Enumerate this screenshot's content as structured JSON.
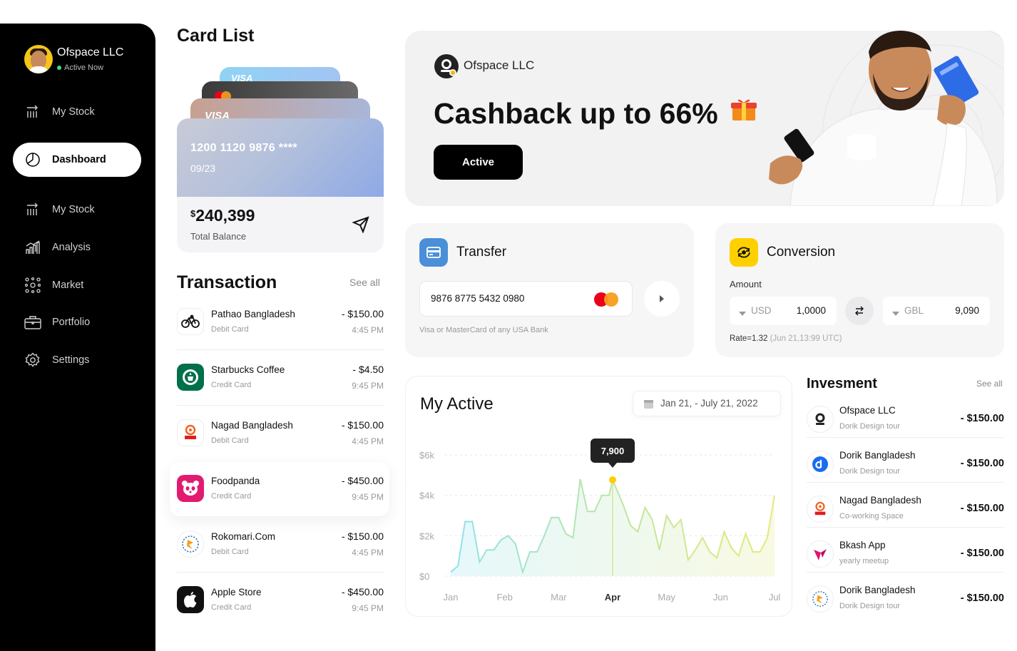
{
  "sidebar": {
    "org_name": "Ofspace LLC",
    "status": "Active Now",
    "items": [
      {
        "label": "My Stock",
        "icon": "stock-icon"
      },
      {
        "label": "Dashboard",
        "icon": "pie-chart-icon",
        "active": true
      },
      {
        "label": "My Stock",
        "icon": "stock-icon"
      },
      {
        "label": "Analysis",
        "icon": "bar-chart-icon"
      },
      {
        "label": "Market",
        "icon": "network-icon"
      },
      {
        "label": "Portfolio",
        "icon": "briefcase-icon"
      },
      {
        "label": "Settings",
        "icon": "gear-icon"
      }
    ]
  },
  "card_list": {
    "title": "Card List",
    "card_number": "1200 1120 9876 ****",
    "expiry": "09/23",
    "brand_back": "VISA",
    "currency_symbol": "$",
    "balance": "240,399",
    "balance_label": "Total Balance"
  },
  "transactions": {
    "title": "Transaction",
    "see_all": "See all",
    "rows": [
      {
        "name": "Pathao Bangladesh",
        "type": "Debit Card",
        "amount": "- $150.00",
        "time": "4:45 PM",
        "logo": "bicycle-icon"
      },
      {
        "name": "Starbucks Coffee",
        "type": "Credit Card",
        "amount": "- $4.50",
        "time": "9:45 PM",
        "logo": "starbucks-icon"
      },
      {
        "name": "Nagad Bangladesh",
        "type": "Debit Card",
        "amount": "- $150.00",
        "time": "4:45 PM",
        "logo": "nagad-icon"
      },
      {
        "name": "Foodpanda",
        "type": "Credit Card",
        "amount": "- $450.00",
        "time": "9:45 PM",
        "logo": "foodpanda-icon"
      },
      {
        "name": "Rokomari.Com",
        "type": "Debit Card",
        "amount": "- $150.00",
        "time": "4:45 PM",
        "logo": "rokomari-icon"
      },
      {
        "name": "Apple Store",
        "type": "Credit Card",
        "amount": "- $450.00",
        "time": "9:45 PM",
        "logo": "apple-icon"
      }
    ]
  },
  "banner": {
    "brand": "Ofspace LLC",
    "headline": "Cashback up to 66%",
    "button": "Active",
    "accent": "#000000"
  },
  "transfer": {
    "title": "Transfer",
    "card_value": "9876 8775 5432 0980",
    "hint": "Visa or MasterCard of any USA Bank"
  },
  "conversion": {
    "title": "Conversion",
    "amount_label": "Amount",
    "from_currency": "USD",
    "from_value": "1,0000",
    "to_currency": "GBL",
    "to_value": "9,090",
    "rate_prefix": "Rate=1.32",
    "rate_time": "(Jun 21,13:99 UTC)"
  },
  "my_active": {
    "title": "My Active",
    "date_range": "Jan 21,  - July 21,  2022",
    "tooltip": "7,900"
  },
  "chart_data": {
    "type": "area",
    "x": [
      "Jan",
      "",
      "",
      "",
      "Feb",
      "",
      "",
      "",
      "Mar",
      "",
      "",
      "",
      "Apr",
      "",
      "",
      "",
      "May",
      "",
      "",
      "",
      "Jun",
      "",
      "",
      "",
      "Jul"
    ],
    "x_ticks": [
      "Jan",
      "Feb",
      "Mar",
      "Apr",
      "May",
      "Jun",
      "Jul"
    ],
    "y_ticks": [
      "$0",
      "$2k",
      "$4k",
      "$6k"
    ],
    "ylim": [
      0,
      6000
    ],
    "points": [
      200,
      500,
      2700,
      2700,
      700,
      1300,
      1300,
      1800,
      2000,
      1600,
      200,
      1200,
      1200,
      2000,
      2900,
      2900,
      2100,
      1900,
      4800,
      3200,
      3200,
      4000,
      4000,
      4800,
      3500,
      2500,
      2200,
      3400,
      2800,
      1300,
      3000,
      2400,
      2800,
      800,
      1300,
      1900,
      1200,
      900,
      2200,
      1400,
      1000,
      2100,
      1200,
      1200,
      1900,
      4000
    ],
    "highlight": {
      "x": "Apr",
      "value": 7900
    },
    "grid": true
  },
  "investment": {
    "title": "Invesment",
    "see_all": "See all",
    "rows": [
      {
        "name": "Ofspace LLC",
        "sub": "Dorik Design tour",
        "amount": "- $150.00",
        "logo": "ofspace-icon"
      },
      {
        "name": "Dorik Bangladesh",
        "sub": "Dorik Design tour",
        "amount": "- $150.00",
        "logo": "dorik-icon"
      },
      {
        "name": "Nagad Bangladesh",
        "sub": "Co-working Space",
        "amount": "- $150.00",
        "logo": "nagad-icon"
      },
      {
        "name": "Bkash App",
        "sub": "yearly meetup",
        "amount": "- $150.00",
        "logo": "bkash-icon"
      },
      {
        "name": "Dorik Bangladesh",
        "sub": "Dorik Design tour",
        "amount": "- $150.00",
        "logo": "rokomari-icon"
      }
    ]
  }
}
